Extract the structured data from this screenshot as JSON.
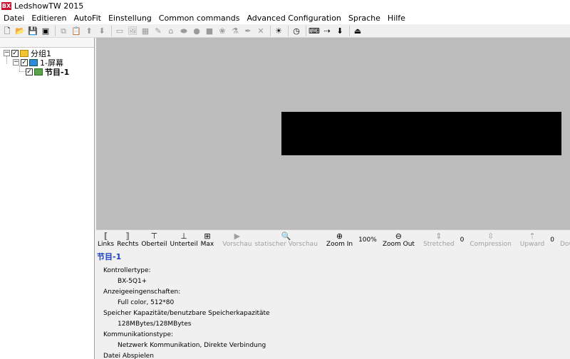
{
  "window": {
    "title": "LedshowTW 2015",
    "app_icon_text": "BX"
  },
  "menu": [
    "Datei",
    "Editieren",
    "AutoFit",
    "Einstellung",
    "Common commands",
    "Advanced Configuration",
    "Sprache",
    "Hilfe"
  ],
  "toolbar": {
    "buttons": [
      {
        "name": "new-file-icon",
        "glyph": "🗋",
        "enabled": true
      },
      {
        "name": "open-folder-icon",
        "glyph": "📂",
        "enabled": true
      },
      {
        "name": "save-icon",
        "glyph": "💾",
        "enabled": true
      },
      {
        "name": "send-screen-icon",
        "glyph": "▣",
        "enabled": true
      },
      {
        "name": "copy-icon",
        "glyph": "⧉",
        "enabled": false
      },
      {
        "name": "paste-icon",
        "glyph": "📋",
        "enabled": false
      },
      {
        "name": "move-up-icon",
        "glyph": "⬆",
        "enabled": false
      },
      {
        "name": "move-down-icon",
        "glyph": "⬇",
        "enabled": false
      },
      {
        "name": "add-area-icon",
        "glyph": "▭",
        "enabled": false
      },
      {
        "name": "add-image-icon",
        "glyph": "🖼",
        "enabled": false
      },
      {
        "name": "add-table-icon",
        "glyph": "▦",
        "enabled": false
      },
      {
        "name": "add-text-icon",
        "glyph": "✎",
        "enabled": false
      },
      {
        "name": "add-clock-icon",
        "glyph": "⌂",
        "enabled": false
      },
      {
        "name": "add-shape-icon",
        "glyph": "⬬",
        "enabled": false
      },
      {
        "name": "add-circle-icon",
        "glyph": "●",
        "enabled": false
      },
      {
        "name": "add-square-icon",
        "glyph": "■",
        "enabled": false
      },
      {
        "name": "add-animation-icon",
        "glyph": "❀",
        "enabled": false
      },
      {
        "name": "add-sensor-icon",
        "glyph": "⚗",
        "enabled": false
      },
      {
        "name": "add-effect-icon",
        "glyph": "✒",
        "enabled": false
      },
      {
        "name": "delete-icon",
        "glyph": "✕",
        "enabled": false
      },
      {
        "name": "brightness-icon",
        "glyph": "☀",
        "enabled": true
      },
      {
        "name": "time-sync-icon",
        "glyph": "◷",
        "enabled": true
      },
      {
        "name": "screen-settings-icon",
        "glyph": "⌨",
        "enabled": true
      },
      {
        "name": "send-data-icon",
        "glyph": "⇢",
        "enabled": true
      },
      {
        "name": "download-icon",
        "glyph": "⬇",
        "enabled": true
      },
      {
        "name": "exit-icon",
        "glyph": "⏏",
        "enabled": true
      }
    ],
    "separators_after": [
      3,
      7,
      19,
      20,
      21,
      24
    ]
  },
  "tree": {
    "nodes": [
      {
        "label": "分组1",
        "level": 0,
        "expanded": true,
        "checked": true,
        "icon": "folder-icon"
      },
      {
        "label": "1-屏幕",
        "level": 1,
        "expanded": true,
        "checked": true,
        "icon": "screen-icon"
      },
      {
        "label": "节目-1",
        "level": 2,
        "expanded": false,
        "checked": true,
        "icon": "program-icon",
        "selected": true
      }
    ]
  },
  "viewbar": {
    "items": [
      {
        "type": "button",
        "name": "align-left-button",
        "icon": "⟦",
        "label": "Links",
        "enabled": true
      },
      {
        "type": "button",
        "name": "align-right-button",
        "icon": "⟧",
        "label": "Rechts",
        "enabled": true
      },
      {
        "type": "button",
        "name": "align-top-button",
        "icon": "⊤",
        "label": "Oberteil",
        "enabled": true
      },
      {
        "type": "button",
        "name": "align-bottom-button",
        "icon": "⊥",
        "label": "Unterteil",
        "enabled": true
      },
      {
        "type": "button",
        "name": "maximize-button",
        "icon": "⊞",
        "label": "Max",
        "enabled": true
      },
      {
        "type": "sep"
      },
      {
        "type": "button",
        "name": "preview-button",
        "icon": "▶",
        "label": "Vorschau",
        "enabled": false
      },
      {
        "type": "button",
        "name": "static-preview-button",
        "icon": "🔍",
        "label": "statischer Vorschau",
        "enabled": false
      },
      {
        "type": "sep"
      },
      {
        "type": "button",
        "name": "zoom-in-button",
        "icon": "⊕",
        "label": "Zoom In",
        "enabled": true
      },
      {
        "type": "value",
        "name": "zoom-level",
        "value": "100%"
      },
      {
        "type": "button",
        "name": "zoom-out-button",
        "icon": "⊖",
        "label": "Zoom Out",
        "enabled": true
      },
      {
        "type": "sep"
      },
      {
        "type": "button",
        "name": "stretched-button",
        "icon": "⇕",
        "label": "Stretched",
        "enabled": false
      },
      {
        "type": "value",
        "name": "stretch-value",
        "value": "0"
      },
      {
        "type": "button",
        "name": "compression-button",
        "icon": "⇳",
        "label": "Compression",
        "enabled": false
      },
      {
        "type": "sep"
      },
      {
        "type": "button",
        "name": "upward-button",
        "icon": "⇡",
        "label": "Upward",
        "enabled": false
      },
      {
        "type": "value",
        "name": "shift-value",
        "value": "0"
      },
      {
        "type": "button",
        "name": "downward-button",
        "icon": "⇣",
        "label": "Downward",
        "enabled": false
      }
    ]
  },
  "info": {
    "title": "节目-1",
    "rows": [
      {
        "label": "Kontrollertype:",
        "value": "BX-5Q1+"
      },
      {
        "label": "Anzeigeeingenschaften:",
        "value": "Full color, 512*80"
      },
      {
        "label": "Speicher Kapazitäte/benutzbare Speicherkapazitäte",
        "value": "128MBytes/128MBytes"
      },
      {
        "label": "Kommunikationstype:",
        "value": "Netzwerk Kommunikation, Direkte Verbindung"
      },
      {
        "label": "Datei Abspielen",
        "value": ""
      }
    ]
  }
}
